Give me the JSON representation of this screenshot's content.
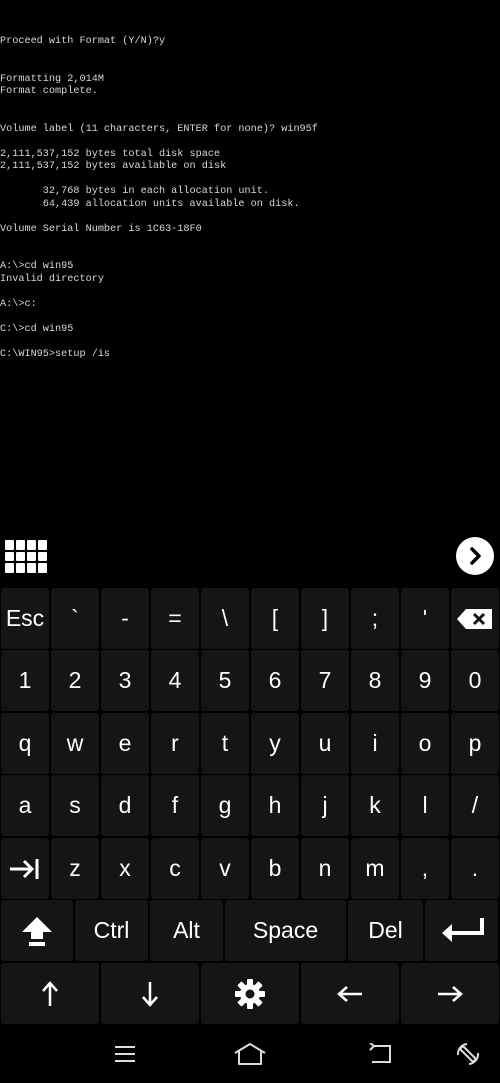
{
  "terminal": {
    "text": "Proceed with Format (Y/N)?y\n\n\nFormatting 2,014M\nFormat complete.\n\n\nVolume label (11 characters, ENTER for none)? win95f\n\n2,111,537,152 bytes total disk space\n2,111,537,152 bytes available on disk\n\n       32,768 bytes in each allocation unit.\n       64,439 allocation units available on disk.\n\nVolume Serial Number is 1C63-18F0\n\n\nA:\\>cd win95\nInvalid directory\n\nA:\\>c:\n\nC:\\>cd win95\n\nC:\\WIN95>setup /is"
  },
  "toolbar": {
    "menu_icon": "grid-menu-icon",
    "next_icon": "chevron-right-circle-icon"
  },
  "keyboard": {
    "rows": [
      [
        "Esc",
        "`",
        "-",
        "=",
        "\\",
        "[",
        "]",
        ";",
        "'",
        "backspace-icon"
      ],
      [
        "1",
        "2",
        "3",
        "4",
        "5",
        "6",
        "7",
        "8",
        "9",
        "0"
      ],
      [
        "q",
        "w",
        "e",
        "r",
        "t",
        "y",
        "u",
        "i",
        "o",
        "p"
      ],
      [
        "a",
        "s",
        "d",
        "f",
        "g",
        "h",
        "j",
        "k",
        "l",
        "/"
      ],
      [
        "tab-icon",
        "z",
        "x",
        "c",
        "v",
        "b",
        "n",
        "m",
        ",",
        "."
      ]
    ],
    "row6": [
      "shift-icon",
      "Ctrl",
      "Alt",
      "Space",
      "Del",
      "enter-icon"
    ],
    "row7": [
      "arrow-up-icon",
      "arrow-down-icon",
      "settings-gear-icon",
      "arrow-left-icon",
      "arrow-right-icon"
    ]
  },
  "navbar": {
    "icons": [
      "recent-apps-icon",
      "home-icon",
      "back-icon",
      "rotate-icon"
    ]
  },
  "colors": {
    "background": "#000000",
    "key_background": "#151515",
    "terminal_text": "#d8d8d8"
  }
}
